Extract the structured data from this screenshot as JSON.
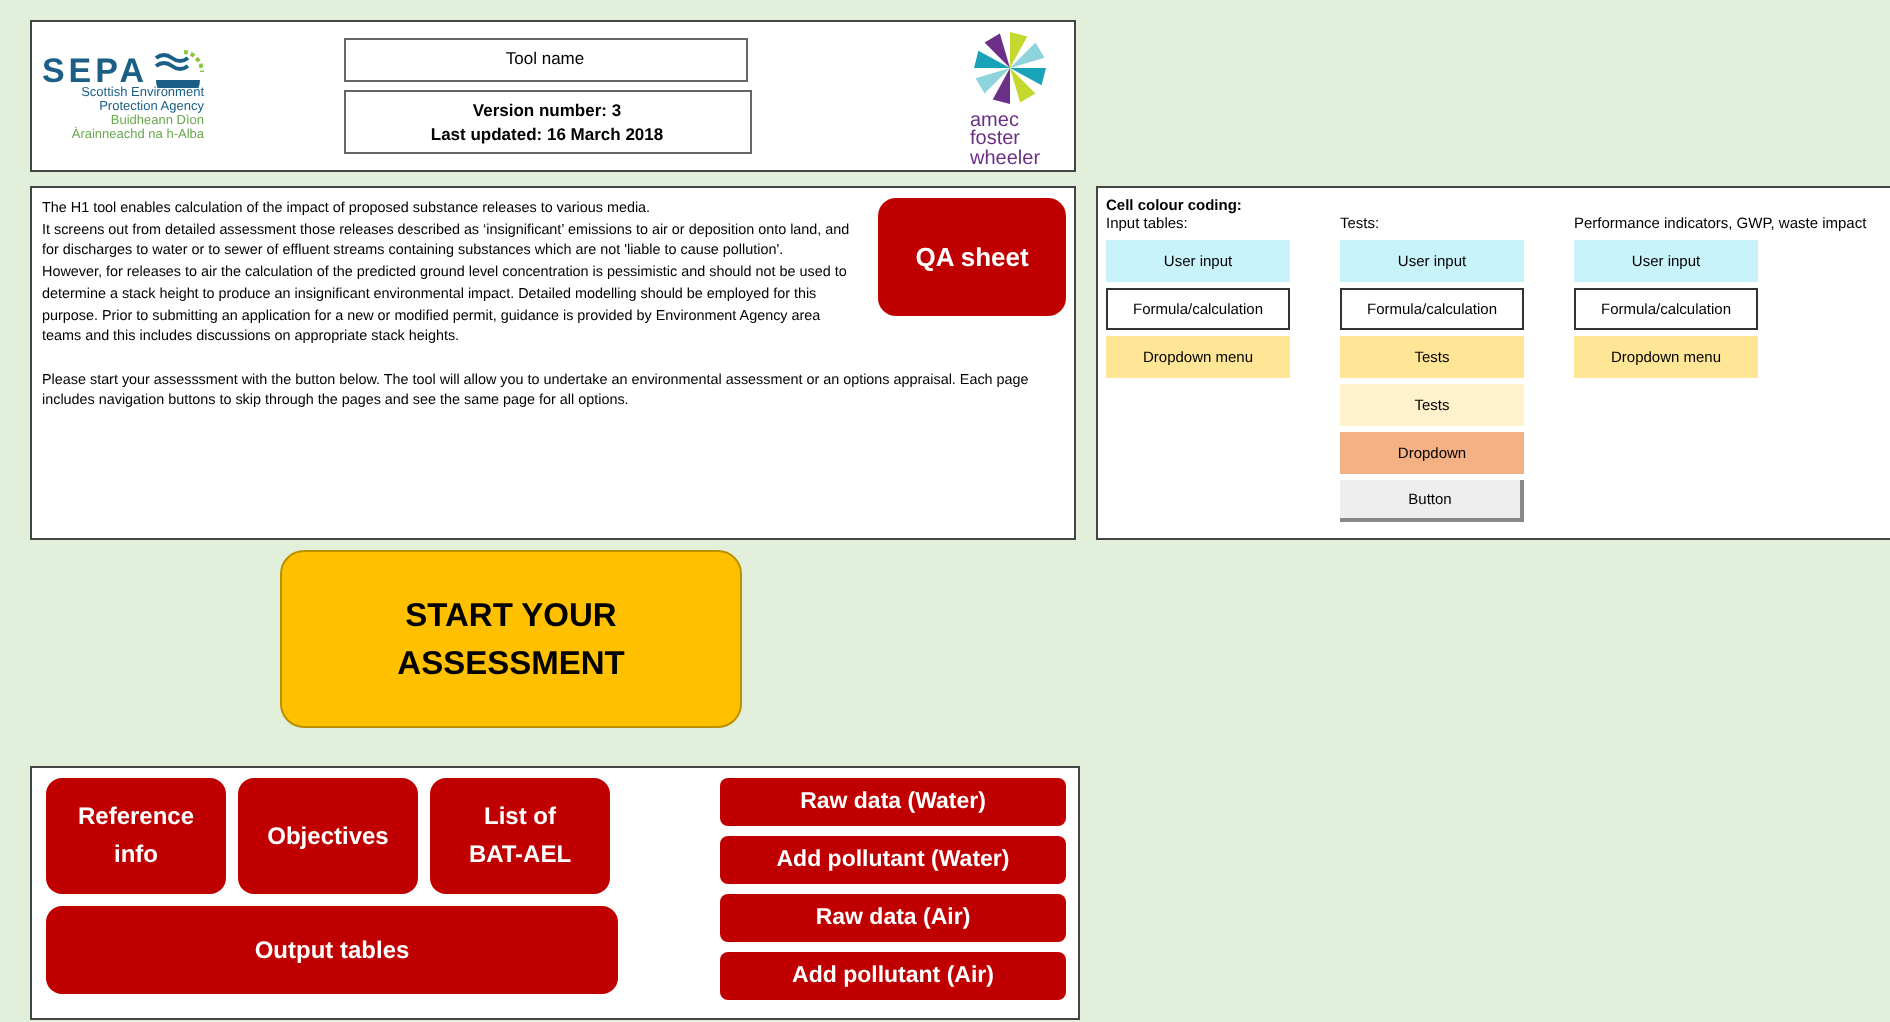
{
  "header": {
    "sepa_logo": {
      "acronym": "SEPA",
      "name_lines": [
        "Scottish Environment",
        "Protection Agency"
      ],
      "gaelic_lines": [
        "Buidheann Dìon",
        "Àrainneachd na h-Alba"
      ]
    },
    "tool_name": "Tool name",
    "version": "Version number: 3",
    "updated": "Last updated: 16 March 2018",
    "partner_logo": {
      "lines": [
        "amec",
        "foster",
        "wheeler"
      ]
    }
  },
  "description": {
    "paragraphs": [
      "The H1 tool enables calculation of the impact of proposed substance releases to various media.",
      "It screens out from detailed assessment those releases described as ‘insignificant’ emissions to air or deposition onto land, and for discharges to water or to sewer of effluent streams containing substances which are not 'liable to cause pollution'.",
      "However, for releases to air the calculation of the predicted ground level concentration is pessimistic and should not be used to determine a stack height to produce an insignificant environmental impact. Detailed modelling should be employed for this purpose. Prior to submitting an application for a new or modified permit, guidance is provided by Environment Agency area teams and this includes discussions on appropriate stack heights.",
      "Please start your assesssment with the button below. The tool will allow you to undertake an environmental assessment or an options appraisal. Each page includes navigation buttons to skip through the pages and see the same page for all options."
    ],
    "qa_button": "QA sheet"
  },
  "colour_coding": {
    "title": "Cell colour coding:",
    "groups": [
      {
        "heading": "Input tables:",
        "cells": [
          {
            "kind": "input",
            "label": "User input"
          },
          {
            "kind": "formula",
            "label": "Formula/calculation"
          },
          {
            "kind": "dropdown",
            "label": "Dropdown menu"
          }
        ]
      },
      {
        "heading": "Tests:",
        "cells": [
          {
            "kind": "input",
            "label": "User input"
          },
          {
            "kind": "formula",
            "label": "Formula/calculation"
          },
          {
            "kind": "dropdown",
            "label": "Tests"
          },
          {
            "kind": "test_light",
            "label": "Tests"
          },
          {
            "kind": "dropdown_strong",
            "label": "Dropdown"
          },
          {
            "kind": "button",
            "label": "Button"
          }
        ]
      },
      {
        "heading": "Performance indicators, GWP, waste impact",
        "cells": [
          {
            "kind": "input",
            "label": "User input"
          },
          {
            "kind": "formula",
            "label": "Formula/calculation"
          },
          {
            "kind": "dropdown",
            "label": "Dropdown menu"
          }
        ]
      }
    ]
  },
  "start_button": "START YOUR ASSESSMENT",
  "navigation": {
    "tiles": [
      "Reference info",
      "Objectives",
      "List of BAT-AEL"
    ],
    "wide_tile": "Output tables",
    "data_buttons": [
      "Raw data (Water)",
      "Add pollutant (Water)",
      "Raw data (Air)",
      "Add pollutant (Air)"
    ]
  }
}
